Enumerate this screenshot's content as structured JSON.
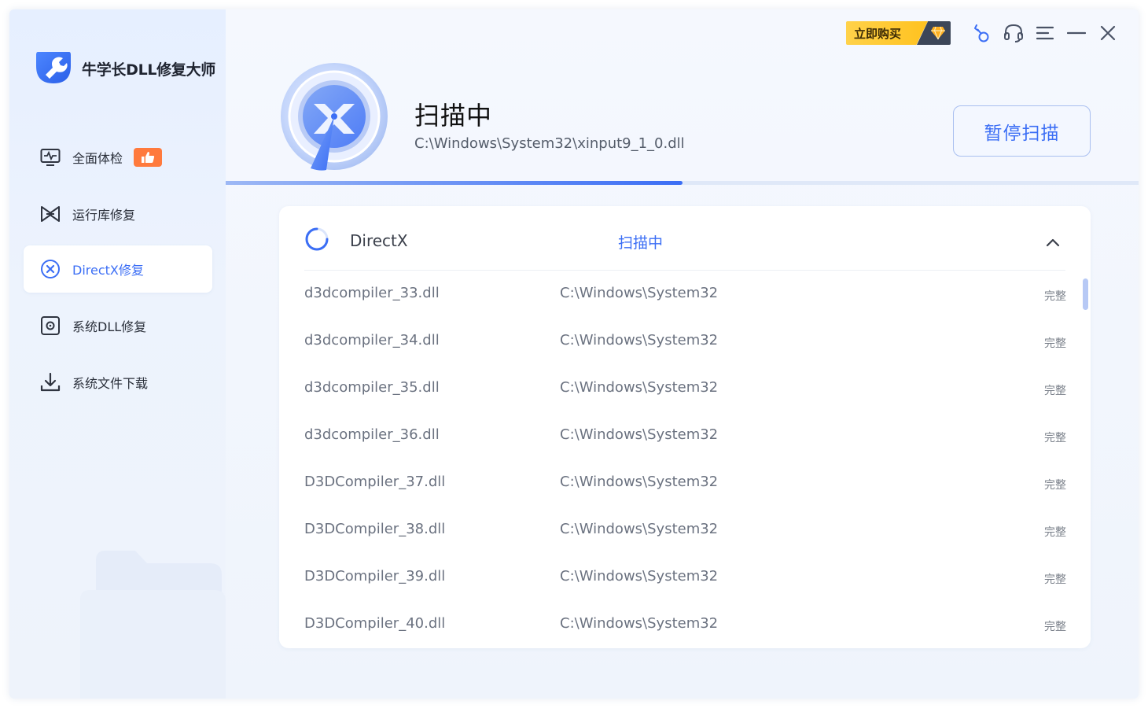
{
  "app": {
    "title": "牛学长DLL修复大师",
    "accent": "#3b6ef5"
  },
  "sidebar": {
    "items": [
      {
        "label": "全面体检",
        "icon": "pulse-monitor-icon",
        "badge_icon": "thumbs-up-icon"
      },
      {
        "label": "运行库修复",
        "icon": "bowtie-icon"
      },
      {
        "label": "DirectX修复",
        "icon": "x-circle-icon",
        "active": true
      },
      {
        "label": "系统DLL修复",
        "icon": "gear-square-icon"
      },
      {
        "label": "系统文件下载",
        "icon": "download-icon"
      }
    ]
  },
  "topbar": {
    "buy_label": "立即购买",
    "buy_icon": "diamond-icon",
    "icons": [
      "key-icon",
      "headset-icon",
      "menu-icon",
      "minimize-icon",
      "close-icon"
    ]
  },
  "scan": {
    "title": "扫描中",
    "current_file": "C:\\Windows\\System32\\xinput9_1_0.dll",
    "pause_label": "暂停扫描",
    "progress": 0.5
  },
  "group": {
    "name": "DirectX",
    "status": "扫描中",
    "rows": [
      {
        "name": "d3dcompiler_33.dll",
        "path": "C:\\Windows\\System32",
        "status": "完整"
      },
      {
        "name": "d3dcompiler_34.dll",
        "path": "C:\\Windows\\System32",
        "status": "完整"
      },
      {
        "name": "d3dcompiler_35.dll",
        "path": "C:\\Windows\\System32",
        "status": "完整"
      },
      {
        "name": "d3dcompiler_36.dll",
        "path": "C:\\Windows\\System32",
        "status": "完整"
      },
      {
        "name": "D3DCompiler_37.dll",
        "path": "C:\\Windows\\System32",
        "status": "完整"
      },
      {
        "name": "D3DCompiler_38.dll",
        "path": "C:\\Windows\\System32",
        "status": "完整"
      },
      {
        "name": "D3DCompiler_39.dll",
        "path": "C:\\Windows\\System32",
        "status": "完整"
      },
      {
        "name": "D3DCompiler_40.dll",
        "path": "C:\\Windows\\System32",
        "status": "完整"
      }
    ]
  }
}
